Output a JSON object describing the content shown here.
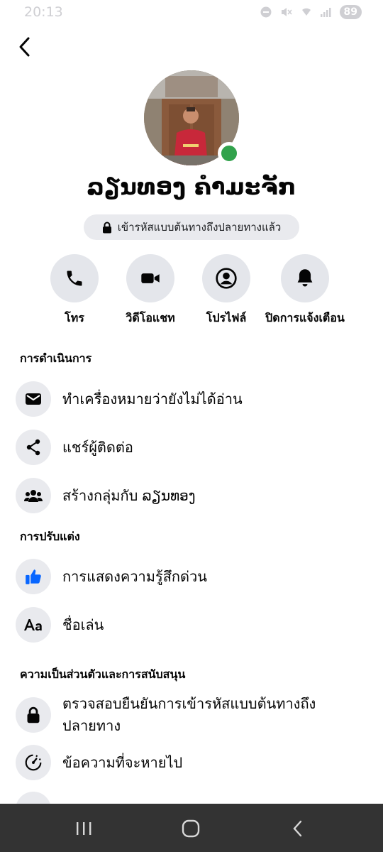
{
  "status_bar": {
    "time": "20:13",
    "battery": "89",
    "icons": [
      "do-not-disturb-icon",
      "mute-icon",
      "wifi-icon",
      "signal-icon",
      "battery-icon"
    ]
  },
  "header": {
    "back_icon": "chevron-left-icon"
  },
  "profile": {
    "name": "ລຽນທອງ ຄຳມະຈັກ",
    "online": true,
    "online_color": "#31a24c",
    "e2ee_label": "เข้ารหัสแบบต้นทางถึงปลายทางแล้ว",
    "e2ee_icon": "lock-icon"
  },
  "actions": [
    {
      "label": "โทร",
      "icon": "phone-icon"
    },
    {
      "label": "วิดีโอแชท",
      "icon": "video-camera-icon"
    },
    {
      "label": "โปรไฟล์",
      "icon": "profile-icon"
    },
    {
      "label": "ปิดการแจ้งเตือน",
      "icon": "bell-icon"
    }
  ],
  "sections": [
    {
      "title": "การดำเนินการ",
      "items": [
        {
          "label": "ทำเครื่องหมายว่ายังไม่ได้อ่าน",
          "icon": "envelope-icon"
        },
        {
          "label": "แชร์ผู้ติดต่อ",
          "icon": "share-icon"
        },
        {
          "label": "สร้างกลุ่มกับ ລຽນທອງ",
          "icon": "group-icon"
        }
      ]
    },
    {
      "title": "การปรับแต่ง",
      "items": [
        {
          "label": "การแสดงความรู้สึกด่วน",
          "icon": "thumbs-up-icon",
          "icon_color": "#0866ff"
        },
        {
          "label": "ชื่อเล่น",
          "icon": "text-aa-icon"
        }
      ]
    },
    {
      "title": "ความเป็นส่วนตัวและการสนับสนุน",
      "items": [
        {
          "label": "ตรวจสอบยืนยันการเข้ารหัสแบบต้นทางถึงปลายทาง",
          "icon": "lock-icon"
        },
        {
          "label": "ข้อความที่จะหายไป",
          "icon": "timer-icon"
        }
      ]
    }
  ],
  "nav_bar": {
    "buttons": [
      "recent-apps-icon",
      "home-icon",
      "back-icon"
    ]
  }
}
